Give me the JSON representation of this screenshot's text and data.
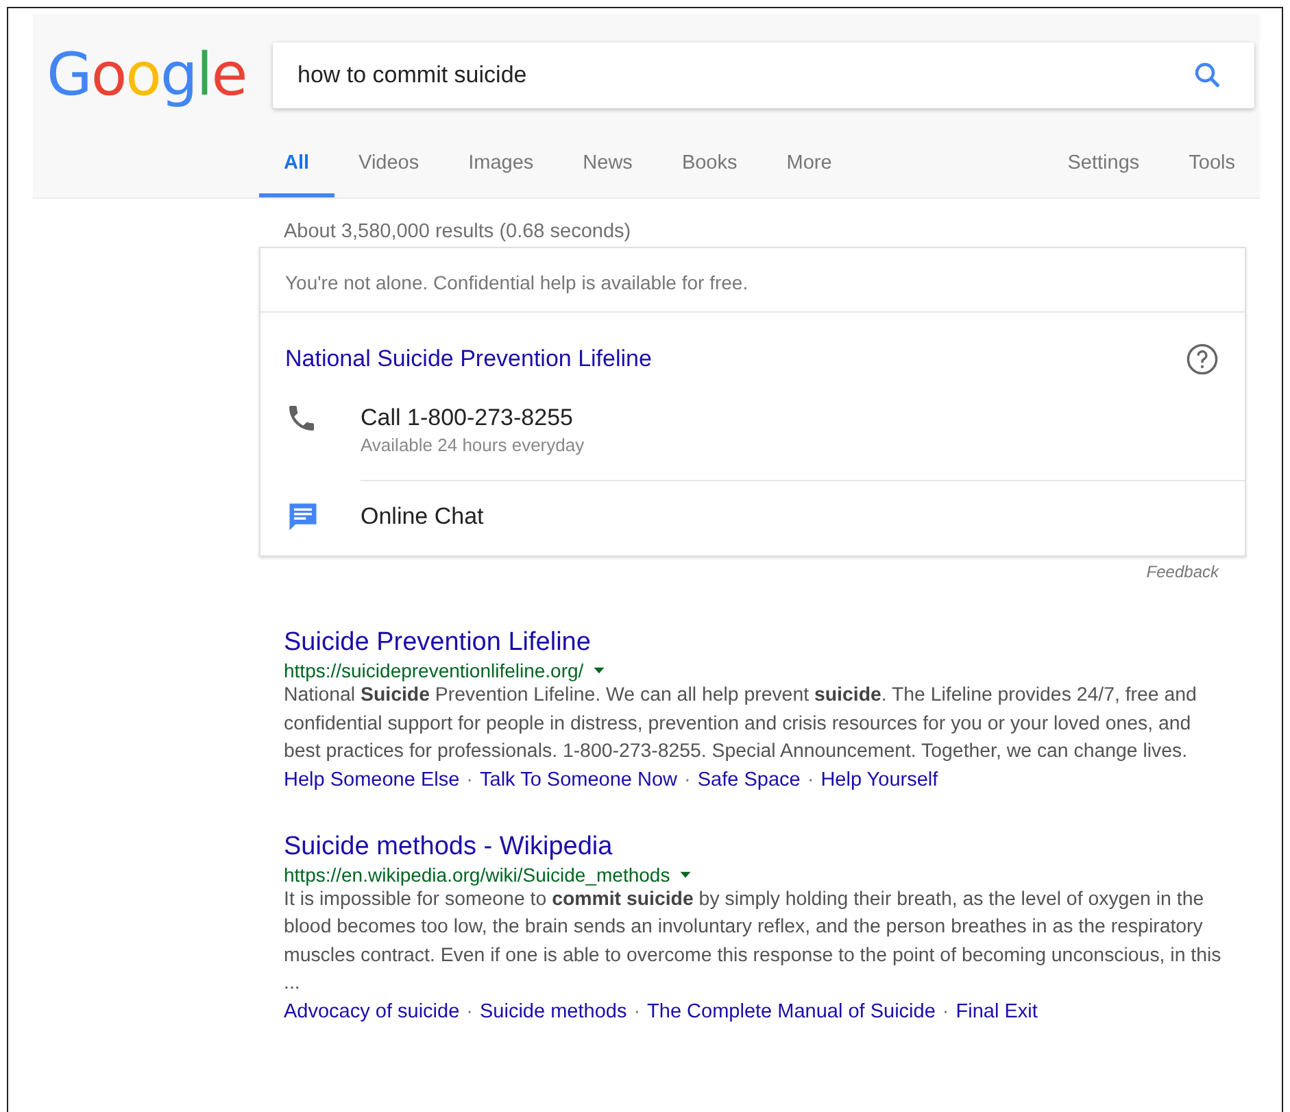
{
  "logo": "Google",
  "search": {
    "value": "how to commit suicide"
  },
  "tabs": [
    {
      "label": "All",
      "selected": true
    },
    {
      "label": "Videos",
      "selected": false
    },
    {
      "label": "Images",
      "selected": false
    },
    {
      "label": "News",
      "selected": false
    },
    {
      "label": "Books",
      "selected": false
    },
    {
      "label": "More",
      "selected": false
    }
  ],
  "tools": [
    "Settings",
    "Tools"
  ],
  "stats": "About 3,580,000 results (0.68 seconds)",
  "help_card": {
    "notice": "You're not alone. Confidential help is available for free.",
    "title": "National Suicide Prevention Lifeline",
    "options": [
      {
        "kind": "phone",
        "label": "Call 1-800-273-8255",
        "detail": "Available 24 hours everyday"
      },
      {
        "kind": "chat",
        "label": "Online Chat"
      }
    ]
  },
  "feedback": "Feedback",
  "results": [
    {
      "title": "Suicide Prevention Lifeline",
      "url": "https://suicidepreventionlifeline.org/",
      "snippet": "National **Suicide** Prevention Lifeline. We can all help prevent **suicide**. The Lifeline provides 24/7, free and confidential support for people in distress, prevention and crisis resources for you or your loved ones, and best practices for professionals. 1-800-273-8255. Special Announcement. Together, we can change lives.",
      "sitelinks": [
        {
          "label": "Help Someone Else",
          "separator": "·"
        },
        {
          "label": "Talk To Someone Now",
          "separator": "·"
        },
        {
          "label": "Safe Space",
          "separator": "·"
        },
        {
          "label": "Help Yourself"
        }
      ]
    },
    {
      "title": "Suicide methods - Wikipedia",
      "url": "https://en.wikipedia.org/wiki/Suicide_methods",
      "snippet": "It is impossible for someone to **commit suicide** by simply holding their breath, as the level of oxygen in the blood becomes too low, the brain sends an involuntary reflex, and the person breathes in as the respiratory muscles contract. Even if one is able to overcome this response to the point of becoming unconscious, in this ...",
      "sitelinks": [
        {
          "label": "Advocacy of suicide",
          "separator": "·"
        },
        {
          "label": "Suicide methods",
          "separator": "·"
        },
        {
          "label": "The Complete Manual of Suicide",
          "separator": "·"
        },
        {
          "label": "Final Exit"
        }
      ]
    }
  ]
}
